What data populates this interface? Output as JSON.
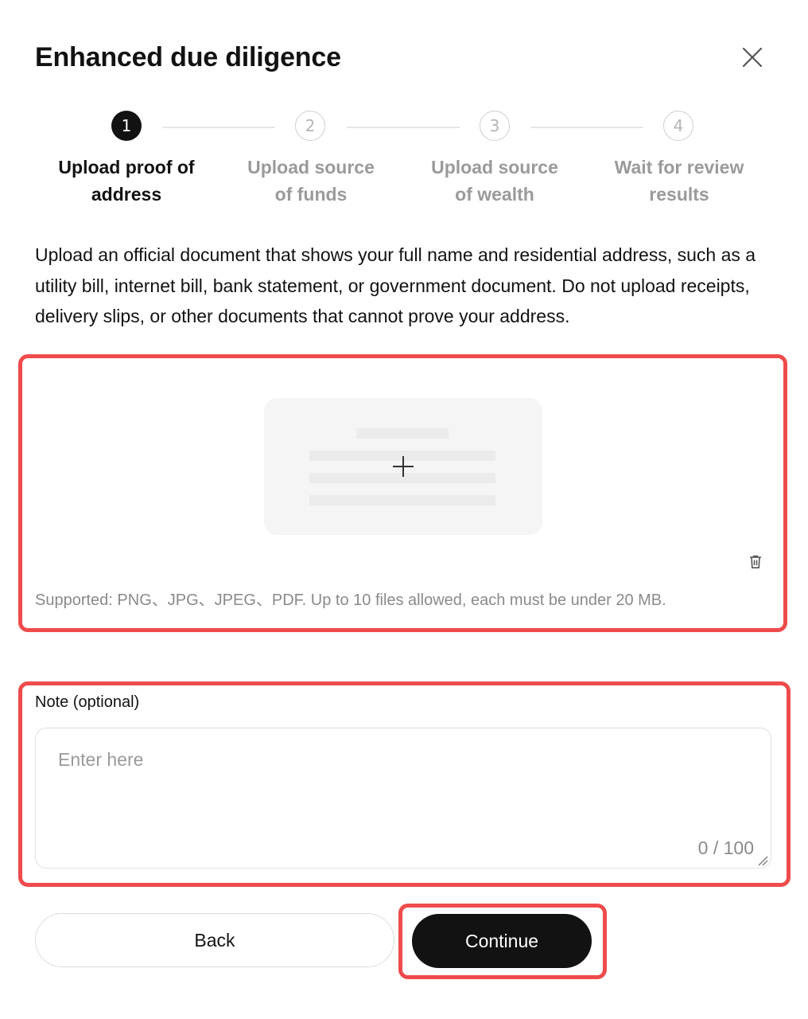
{
  "dialog": {
    "title": "Enhanced due diligence",
    "close_icon": "close-icon"
  },
  "stepper": {
    "steps": [
      {
        "number": "1",
        "label_line1": "Upload proof of",
        "label_line2": "address",
        "state": "active"
      },
      {
        "number": "2",
        "label_line1": "Upload source",
        "label_line2": "of funds",
        "state": "inactive"
      },
      {
        "number": "3",
        "label_line1": "Upload source",
        "label_line2": "of wealth",
        "state": "inactive"
      },
      {
        "number": "4",
        "label_line1": "Wait for review",
        "label_line2": "results",
        "state": "inactive"
      }
    ]
  },
  "instructions": "Upload an official document that shows your full name and residential address, such as a utility bill, internet bill, bank statement, or government document. Do not upload receipts, delivery slips, or other documents that cannot prove your address.",
  "upload": {
    "add_icon": "plus-icon",
    "delete_icon": "trash-icon",
    "hint": "Supported: PNG、JPG、JPEG、PDF. Up to 10 files allowed, each must be under 20 MB."
  },
  "note": {
    "label": "Note (optional)",
    "placeholder": "Enter here",
    "counter": "0 / 100"
  },
  "actions": {
    "back_label": "Back",
    "continue_label": "Continue"
  },
  "colors": {
    "highlight": "#ef4b4b",
    "primary": "#121212",
    "muted": "#9a9a9a"
  }
}
